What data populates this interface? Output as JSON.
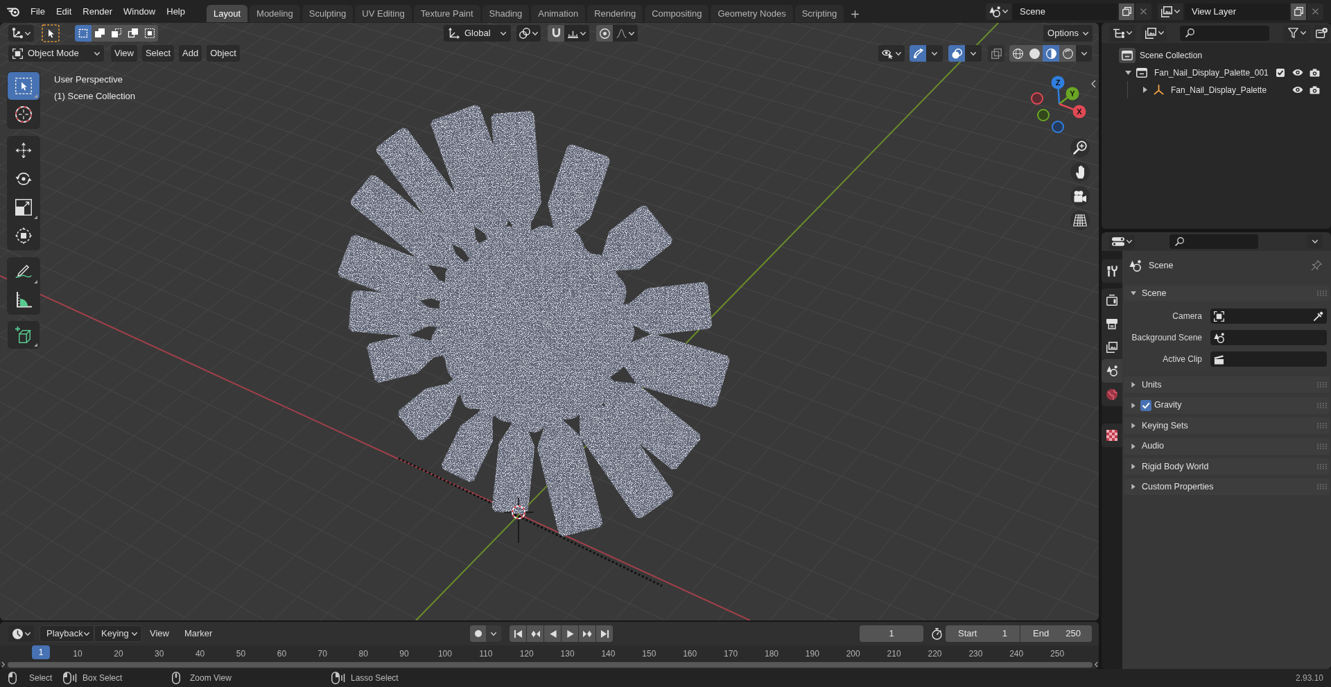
{
  "top_bar": {
    "menus": [
      "File",
      "Edit",
      "Render",
      "Window",
      "Help"
    ],
    "workspaces": [
      {
        "label": "Layout",
        "selected": true
      },
      {
        "label": "Modeling",
        "selected": false
      },
      {
        "label": "Sculpting",
        "selected": false
      },
      {
        "label": "UV Editing",
        "selected": false
      },
      {
        "label": "Texture Paint",
        "selected": false
      },
      {
        "label": "Shading",
        "selected": false
      },
      {
        "label": "Animation",
        "selected": false
      },
      {
        "label": "Rendering",
        "selected": false
      },
      {
        "label": "Compositing",
        "selected": false
      },
      {
        "label": "Geometry Nodes",
        "selected": false
      },
      {
        "label": "Scripting",
        "selected": false
      }
    ],
    "scene": "Scene",
    "view_layer": "View Layer"
  },
  "viewport": {
    "header": {
      "select_modes": [
        {
          "selected": true
        },
        {
          "selected": false
        },
        {
          "selected": false
        },
        {
          "selected": false
        },
        {
          "selected": false
        }
      ],
      "orientation": "Global",
      "snapping": {
        "on": false
      },
      "proportional_editing": {
        "on": false
      },
      "options": "Options",
      "mode": "Object Mode",
      "menus": [
        "View",
        "Select",
        "Add",
        "Object"
      ],
      "gizmos": {
        "on": true
      },
      "overlays": {
        "on": true
      },
      "xray": {
        "on": false
      },
      "shading": [
        {
          "selected": false
        },
        {
          "selected": false
        },
        {
          "selected": true
        },
        {
          "selected": false
        }
      ]
    },
    "overlay_text": [
      "User Perspective",
      "(1) Scene Collection"
    ],
    "tool_groups": [
      {
        "tools": [
          {
            "selected": true
          },
          {
            "selected": false
          }
        ]
      },
      {
        "tools": [
          {
            "selected": false
          },
          {
            "selected": false
          },
          {
            "selected": false
          },
          {
            "selected": false
          }
        ]
      },
      {
        "tools": [
          {
            "selected": false
          },
          {
            "selected": false
          }
        ]
      },
      {
        "tools": [
          {
            "selected": false
          }
        ]
      }
    ],
    "navigation_gizmo": {
      "axes": [
        "Z",
        "Y",
        "X"
      ]
    }
  },
  "outliner": {
    "tree": [
      {
        "label": "Scene Collection",
        "kind": "scene_collection",
        "children": [
          {
            "label": "Fan_Nail_Display_Palette_001",
            "kind": "collection",
            "expanded": true,
            "checked": true,
            "children": [
              {
                "label": "Fan_Nail_Display_Palette",
                "kind": "object",
                "expanded": false
              }
            ]
          }
        ]
      }
    ]
  },
  "properties": {
    "tab_groups": [
      {
        "tabs": [
          {
            "selected": false
          }
        ]
      },
      {
        "tabs": [
          {
            "selected": false
          },
          {
            "selected": false
          },
          {
            "selected": false
          },
          {
            "selected": true
          },
          {
            "selected": false
          }
        ]
      },
      {
        "tabs": [
          {
            "selected": false
          }
        ]
      }
    ],
    "context": "Scene",
    "panels": [
      {
        "title": "Scene",
        "expanded": true,
        "fields": [
          {
            "label": "Camera",
            "kind": "object"
          },
          {
            "label": "Background Scene",
            "kind": "scene"
          },
          {
            "label": "Active Clip",
            "kind": "clip"
          }
        ]
      },
      {
        "title": "Units",
        "expanded": false
      },
      {
        "title": "Gravity",
        "expanded": false,
        "toggle": {
          "checked": true
        }
      },
      {
        "title": "Keying Sets",
        "expanded": false
      },
      {
        "title": "Audio",
        "expanded": false
      },
      {
        "title": "Rigid Body World",
        "expanded": false
      },
      {
        "title": "Custom Properties",
        "expanded": false
      }
    ]
  },
  "timeline": {
    "menus": [
      {
        "label": "Playback",
        "kind": "dropdown"
      },
      {
        "label": "Keying",
        "kind": "dropdown"
      },
      {
        "label": "View",
        "kind": "menu"
      },
      {
        "label": "Marker",
        "kind": "menu"
      }
    ],
    "auto_keying": {
      "on": false
    },
    "current_frame": "1",
    "start": {
      "label": "Start",
      "value": "1"
    },
    "end": {
      "label": "End",
      "value": "250"
    },
    "ruler": {
      "current": "1",
      "ticks": [
        "10",
        "20",
        "30",
        "40",
        "50",
        "60",
        "70",
        "80",
        "90",
        "100",
        "110",
        "120",
        "130",
        "140",
        "150",
        "160",
        "170",
        "180",
        "190",
        "200",
        "210",
        "220",
        "230",
        "240",
        "250"
      ]
    }
  },
  "status_bar": {
    "hints": [
      "Select",
      "Box Select",
      "Zoom View",
      "Lasso Select"
    ],
    "version": "2.93.10"
  }
}
